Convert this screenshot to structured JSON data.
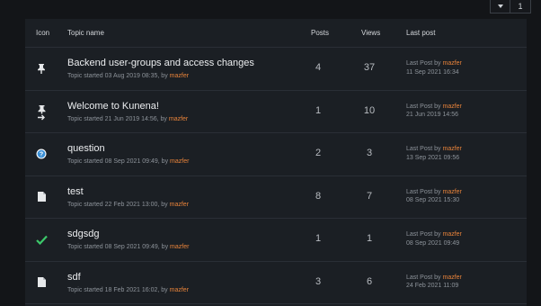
{
  "pagination": {
    "dropdown_icon": "caret-down-icon",
    "current_page": "1"
  },
  "columns": {
    "icon": "Icon",
    "topic": "Topic name",
    "posts": "Posts",
    "views": "Views",
    "last_post": "Last post"
  },
  "topics": [
    {
      "icon": "pin-icon",
      "title": "Backend user-groups and access changes",
      "started_prefix": "Topic started 03 Aug 2019 08:35, by",
      "author": "mazfer",
      "posts": "4",
      "views": "37",
      "last_post_prefix": "Last Post by",
      "last_post_author": "mazfer",
      "last_post_date": "11 Sep 2021 16:34"
    },
    {
      "icon": "pin-arrow-icon",
      "title": "Welcome to Kunena!",
      "started_prefix": "Topic started 21 Jun 2019 14:56, by",
      "author": "mazfer",
      "posts": "1",
      "views": "10",
      "last_post_prefix": "Last Post by",
      "last_post_author": "mazfer",
      "last_post_date": "21 Jun 2019 14:56"
    },
    {
      "icon": "question-icon",
      "title": "question",
      "started_prefix": "Topic started 08 Sep 2021 09:49, by",
      "author": "mazfer",
      "posts": "2",
      "views": "3",
      "last_post_prefix": "Last Post by",
      "last_post_author": "mazfer",
      "last_post_date": "13 Sep 2021 09:56"
    },
    {
      "icon": "document-icon",
      "title": "test",
      "started_prefix": "Topic started 22 Feb 2021 13:00, by",
      "author": "mazfer",
      "posts": "8",
      "views": "7",
      "last_post_prefix": "Last Post by",
      "last_post_author": "mazfer",
      "last_post_date": "08 Sep 2021 15:30"
    },
    {
      "icon": "checkmark-icon",
      "title": "sdgsdg",
      "started_prefix": "Topic started 08 Sep 2021 09:49, by",
      "author": "mazfer",
      "posts": "1",
      "views": "1",
      "last_post_prefix": "Last Post by",
      "last_post_author": "mazfer",
      "last_post_date": "08 Sep 2021 09:49"
    },
    {
      "icon": "document-icon",
      "title": "sdf",
      "started_prefix": "Topic started 18 Feb 2021 16:02, by",
      "author": "mazfer",
      "posts": "3",
      "views": "6",
      "last_post_prefix": "Last Post by",
      "last_post_author": "mazfer",
      "last_post_date": "24 Feb 2021 11:09"
    }
  ],
  "colors": {
    "background": "#131518",
    "table": "#1b1f24",
    "author_link": "#e8833a",
    "question_badge": "#3a8fd6",
    "check": "#3cc86a"
  }
}
